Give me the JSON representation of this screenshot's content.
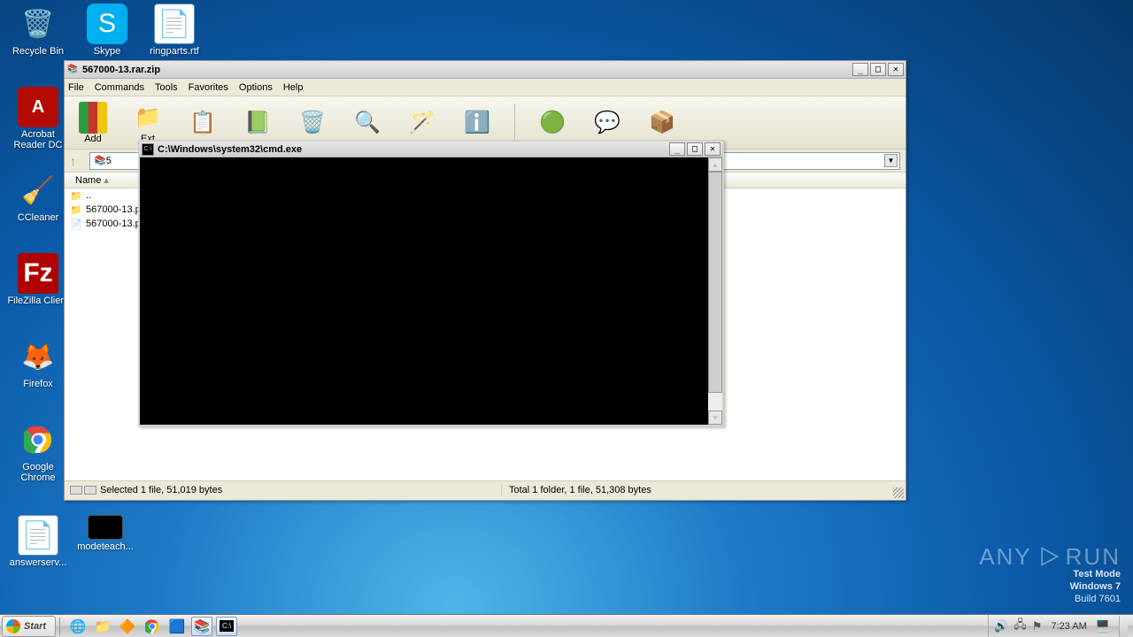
{
  "desktop_icons": {
    "recycle": "Recycle Bin",
    "skype": "Skype",
    "ringparts": "ringparts.rtf",
    "acrobat": "Acrobat Reader DC",
    "ccleaner": "CCleaner",
    "filezilla": "FileZilla Client",
    "firefox": "Firefox",
    "chrome": "Google Chrome",
    "answerserv": "answerserv...",
    "modeteach": "modeteach..."
  },
  "winrar": {
    "title": "567000-13.rar.zip",
    "menu": {
      "file": "File",
      "commands": "Commands",
      "tools": "Tools",
      "favorites": "Favorites",
      "options": "Options",
      "help": "Help"
    },
    "toolbar": {
      "add": "Add",
      "extract": "Ext"
    },
    "path_prefix": "5",
    "columns": {
      "name": "Name"
    },
    "files": {
      "up": "..",
      "f1": "567000-13.p",
      "f2": "567000-13.p"
    },
    "status_left": "Selected 1 file, 51,019 bytes",
    "status_right": "Total 1 folder, 1 file, 51,308 bytes"
  },
  "cmd": {
    "title": "C:\\Windows\\system32\\cmd.exe"
  },
  "watermark": {
    "brand": "ANY",
    "brand2": "RUN",
    "line1": "Test Mode",
    "line2": "Windows 7",
    "line3": "Build 7601"
  },
  "taskbar": {
    "start": "Start",
    "time": "7:23 AM"
  }
}
